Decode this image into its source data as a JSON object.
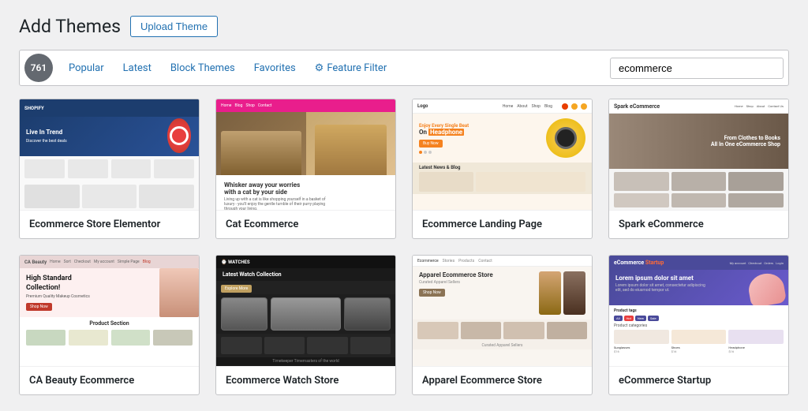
{
  "page": {
    "title": "Add Themes",
    "upload_btn": "Upload Theme",
    "theme_count": "761",
    "search_placeholder": "ecommerce",
    "search_value": "ecommerce"
  },
  "filter_nav": {
    "popular": "Popular",
    "latest": "Latest",
    "block_themes": "Block Themes",
    "favorites": "Favorites",
    "feature_filter": "Feature Filter"
  },
  "themes": [
    {
      "id": "theme-1",
      "name": "Ecommerce Store Elementor"
    },
    {
      "id": "theme-2",
      "name": "Cat Ecommerce"
    },
    {
      "id": "theme-3",
      "name": "Ecommerce Landing Page"
    },
    {
      "id": "theme-4",
      "name": "Spark eCommerce"
    },
    {
      "id": "theme-5",
      "name": "CA Beauty Ecommerce"
    },
    {
      "id": "theme-6",
      "name": "Ecommerce Watch Store"
    },
    {
      "id": "theme-7",
      "name": "Apparel Ecommerce Store"
    },
    {
      "id": "theme-8",
      "name": "eCommerce Startup"
    }
  ]
}
